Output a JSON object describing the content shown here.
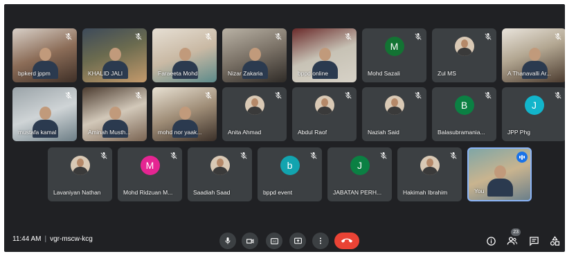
{
  "participants": [
    {
      "name": "bpkerd jppm",
      "type": "video",
      "style": "v1"
    },
    {
      "name": "KHALID JALI",
      "type": "video",
      "style": "v2"
    },
    {
      "name": "Faraeeta Mohd",
      "type": "video",
      "style": "v3"
    },
    {
      "name": "Nizar Zakaria",
      "type": "video",
      "style": "v4"
    },
    {
      "name": "bppd online",
      "type": "video",
      "style": "v5"
    },
    {
      "name": "Mohd Sazali",
      "type": "letter",
      "initial": "M",
      "color": "#137333"
    },
    {
      "name": "Zul MS",
      "type": "photo"
    },
    {
      "name": "A Thanavalli Ar...",
      "type": "video",
      "style": "v6"
    },
    {
      "name": "mustafa kamal",
      "type": "video",
      "style": "v7"
    },
    {
      "name": "Aminah Musth...",
      "type": "video",
      "style": "v8"
    },
    {
      "name": "mohd nor yaak...",
      "type": "video",
      "style": "v9"
    },
    {
      "name": "Anita Ahmad",
      "type": "photo"
    },
    {
      "name": "Abdul Raof",
      "type": "photo"
    },
    {
      "name": "Naziah Said",
      "type": "photo"
    },
    {
      "name": "Balasubramania...",
      "type": "letter",
      "initial": "B",
      "color": "#0b8043"
    },
    {
      "name": "JPP Phg",
      "type": "letter",
      "initial": "J",
      "color": "#12b5cb"
    },
    {
      "name": "Lavaniyan Nathan",
      "type": "photo"
    },
    {
      "name": "Mohd Ridzuan M...",
      "type": "letter",
      "initial": "M",
      "color": "#e52592"
    },
    {
      "name": "Saadiah Saad",
      "type": "photo"
    },
    {
      "name": "bppd event",
      "type": "letter",
      "initial": "b",
      "color": "#12a4af"
    },
    {
      "name": "JABATAN PERH...",
      "type": "letter",
      "initial": "J",
      "color": "#0b8043"
    },
    {
      "name": "Hakimah Ibrahim",
      "type": "photo"
    },
    {
      "name": "You",
      "type": "self"
    }
  ],
  "meeting": {
    "time": "11:44 AM",
    "code": "vgr-mscw-kcg"
  },
  "controls": [
    "mic-icon",
    "camera-icon",
    "captions-icon",
    "present-icon",
    "more-icon",
    "end-call-icon"
  ],
  "right_controls": {
    "info_icon": "info-icon",
    "people_icon": "people-icon",
    "people_count": "23",
    "chat_icon": "chat-icon",
    "activities_icon": "activities-icon"
  }
}
